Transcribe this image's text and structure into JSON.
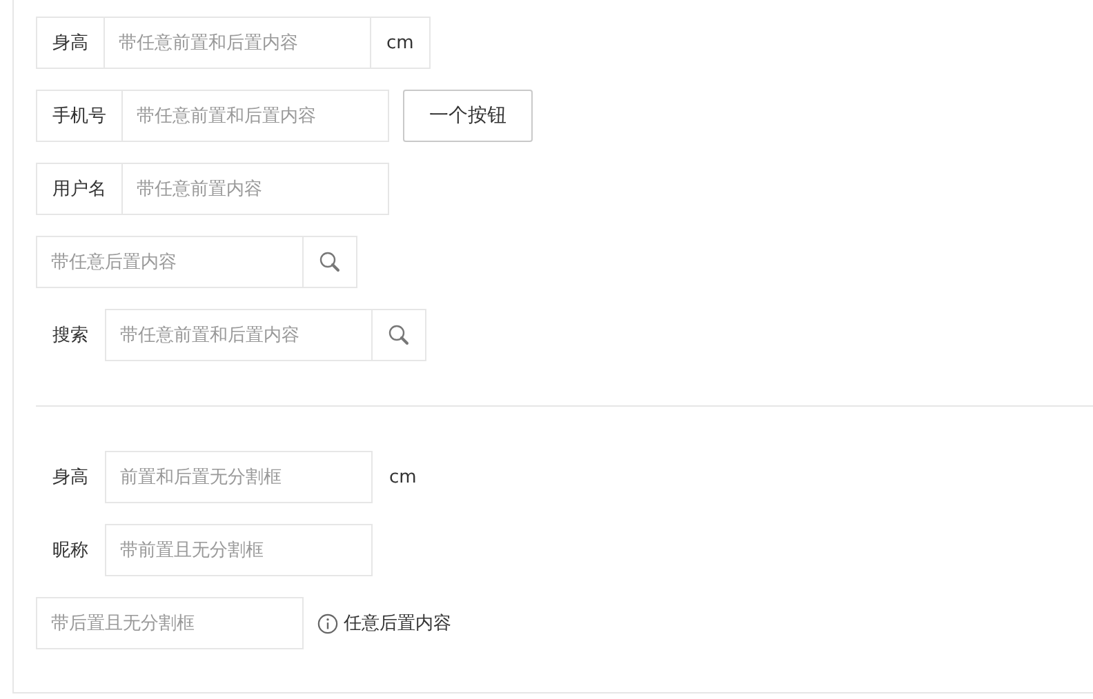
{
  "groups": [
    {
      "rows": [
        {
          "prefix": {
            "text": "身高",
            "bordered": true
          },
          "placeholder": "带任意前置和后置内容",
          "suffix": {
            "kind": "text",
            "text": "cm",
            "bordered": true
          }
        },
        {
          "prefix": {
            "text": "手机号",
            "bordered": true
          },
          "placeholder": "带任意前置和后置内容",
          "button": "一个按钮"
        },
        {
          "prefix": {
            "text": "用户名",
            "bordered": true
          },
          "placeholder": "带任意前置内容"
        },
        {
          "placeholder": "带任意后置内容",
          "suffix": {
            "kind": "search",
            "bordered": true
          }
        },
        {
          "prefix": {
            "text": "搜索",
            "bordered": false
          },
          "placeholder": "带任意前置和后置内容",
          "suffix": {
            "kind": "search",
            "bordered": true
          }
        }
      ]
    },
    {
      "rows": [
        {
          "prefix": {
            "text": "身高",
            "bordered": false
          },
          "placeholder": "前置和后置无分割框",
          "suffix": {
            "kind": "text",
            "text": "cm",
            "bordered": false
          }
        },
        {
          "prefix": {
            "text": "昵称",
            "bordered": false
          },
          "placeholder": "带前置且无分割框"
        },
        {
          "placeholder": "带后置且无分割框",
          "suffix": {
            "kind": "info",
            "text": "任意后置内容"
          }
        }
      ]
    }
  ]
}
